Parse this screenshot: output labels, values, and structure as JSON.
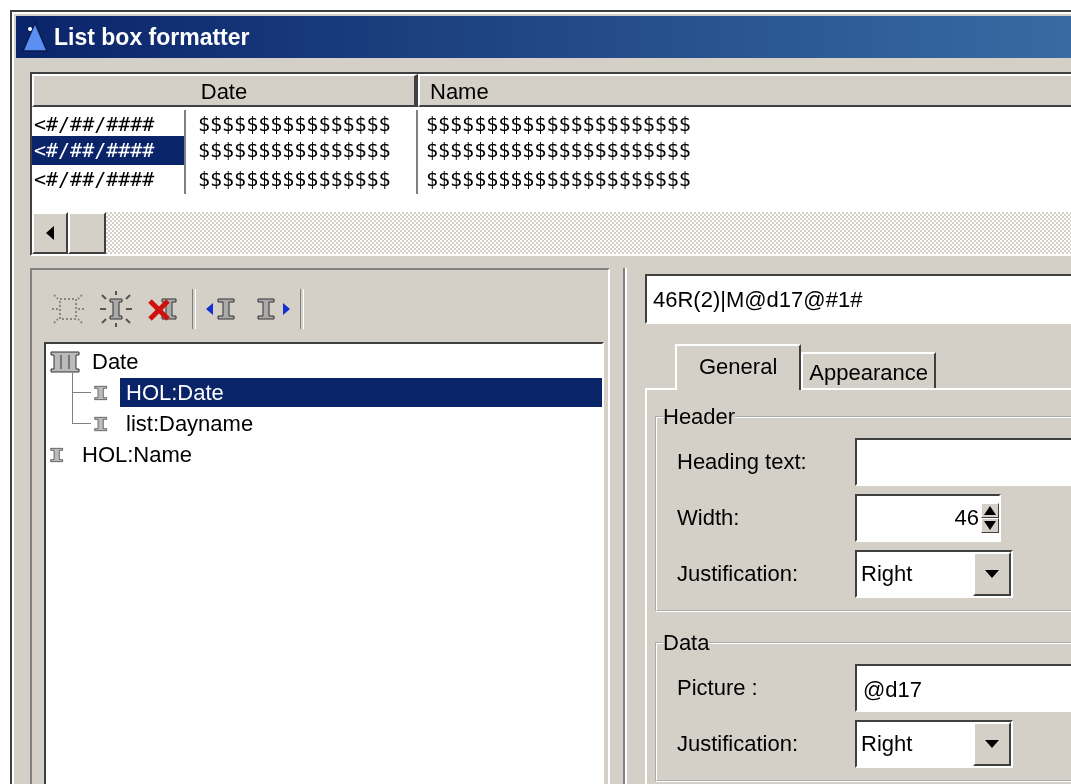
{
  "window": {
    "title": "List box formatter"
  },
  "preview": {
    "columns": [
      {
        "label": "Date"
      },
      {
        "label": "Name"
      }
    ],
    "rows": [
      {
        "date": [
          "<#/##/####",
          "$$$$$$$$$$$$$$$$"
        ],
        "name": "$$$$$$$$$$$$$$$$$$$$$$",
        "selected": false
      },
      {
        "date": [
          "<#/##/####",
          "$$$$$$$$$$$$$$$$"
        ],
        "name": "$$$$$$$$$$$$$$$$$$$$$$",
        "selected": true
      },
      {
        "date": [
          "<#/##/####",
          "$$$$$$$$$$$$$$$$"
        ],
        "name": "$$$$$$$$$$$$$$$$$$$$$$",
        "selected": false
      }
    ]
  },
  "tree": [
    {
      "label": "Date",
      "kind": "group",
      "selected": false,
      "children": [
        {
          "label": "HOL:Date",
          "kind": "field",
          "selected": true
        },
        {
          "label": "list:Dayname",
          "kind": "field",
          "selected": false
        }
      ]
    },
    {
      "label": "HOL:Name",
      "kind": "field",
      "selected": false
    }
  ],
  "format_string": "46R(2)|M@d17@#1#",
  "tabs": [
    {
      "label": "General",
      "selected": true
    },
    {
      "label": "Appearance",
      "selected": false
    }
  ],
  "header_group": {
    "title": "Header",
    "heading_text": {
      "label": "Heading text:"
    },
    "width": {
      "label": "Width:",
      "value": "46"
    },
    "justification": {
      "label": "Justification:",
      "value": "Right"
    }
  },
  "data_group": {
    "title": "Data",
    "picture": {
      "label": "Picture :",
      "value": "@d17"
    },
    "justification": {
      "label": "Justification:",
      "value": "Right"
    }
  }
}
